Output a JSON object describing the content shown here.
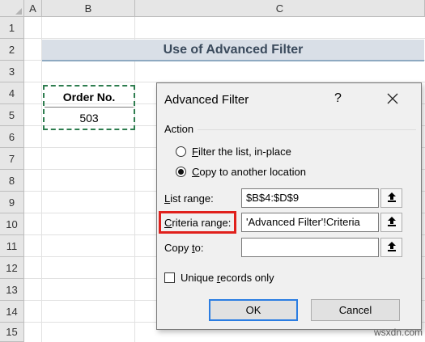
{
  "sheet": {
    "columns": [
      "A",
      "B",
      "C"
    ],
    "rows": [
      "1",
      "2",
      "3",
      "4",
      "5",
      "6",
      "7",
      "8",
      "9",
      "10",
      "11",
      "12",
      "13",
      "14",
      "15"
    ],
    "title": "Use of Advanced Filter",
    "criteria_header": "Order No.",
    "criteria_value": "503",
    "accent_border": "#2e7d4f",
    "title_fill": "#d9dfe7"
  },
  "dialog": {
    "title": "Advanced Filter",
    "help": "?",
    "close_icon": "close-icon",
    "action_label": "Action",
    "options": [
      {
        "prefix": "",
        "accel": "F",
        "rest": "ilter the list, in-place",
        "checked": false
      },
      {
        "prefix": "",
        "accel": "C",
        "rest": "opy to another location",
        "checked": true
      }
    ],
    "list_range": {
      "accel": "L",
      "rest": "ist range:",
      "value": "$B$4:$D$9"
    },
    "criteria_range": {
      "accel": "C",
      "rest": "riteria range:",
      "value": "'Advanced Filter'!Criteria"
    },
    "copy_to": {
      "prefix": "Copy ",
      "accel": "t",
      "rest": "o:",
      "value": ""
    },
    "unique": {
      "prefix": "Unique ",
      "accel": "r",
      "rest": "ecords only",
      "checked": false
    },
    "ok_label": "OK",
    "cancel_label": "Cancel",
    "highlight_color": "#e0201c",
    "ref_icon": "collapse-dialog-icon"
  },
  "watermark": "wsxdn.com"
}
